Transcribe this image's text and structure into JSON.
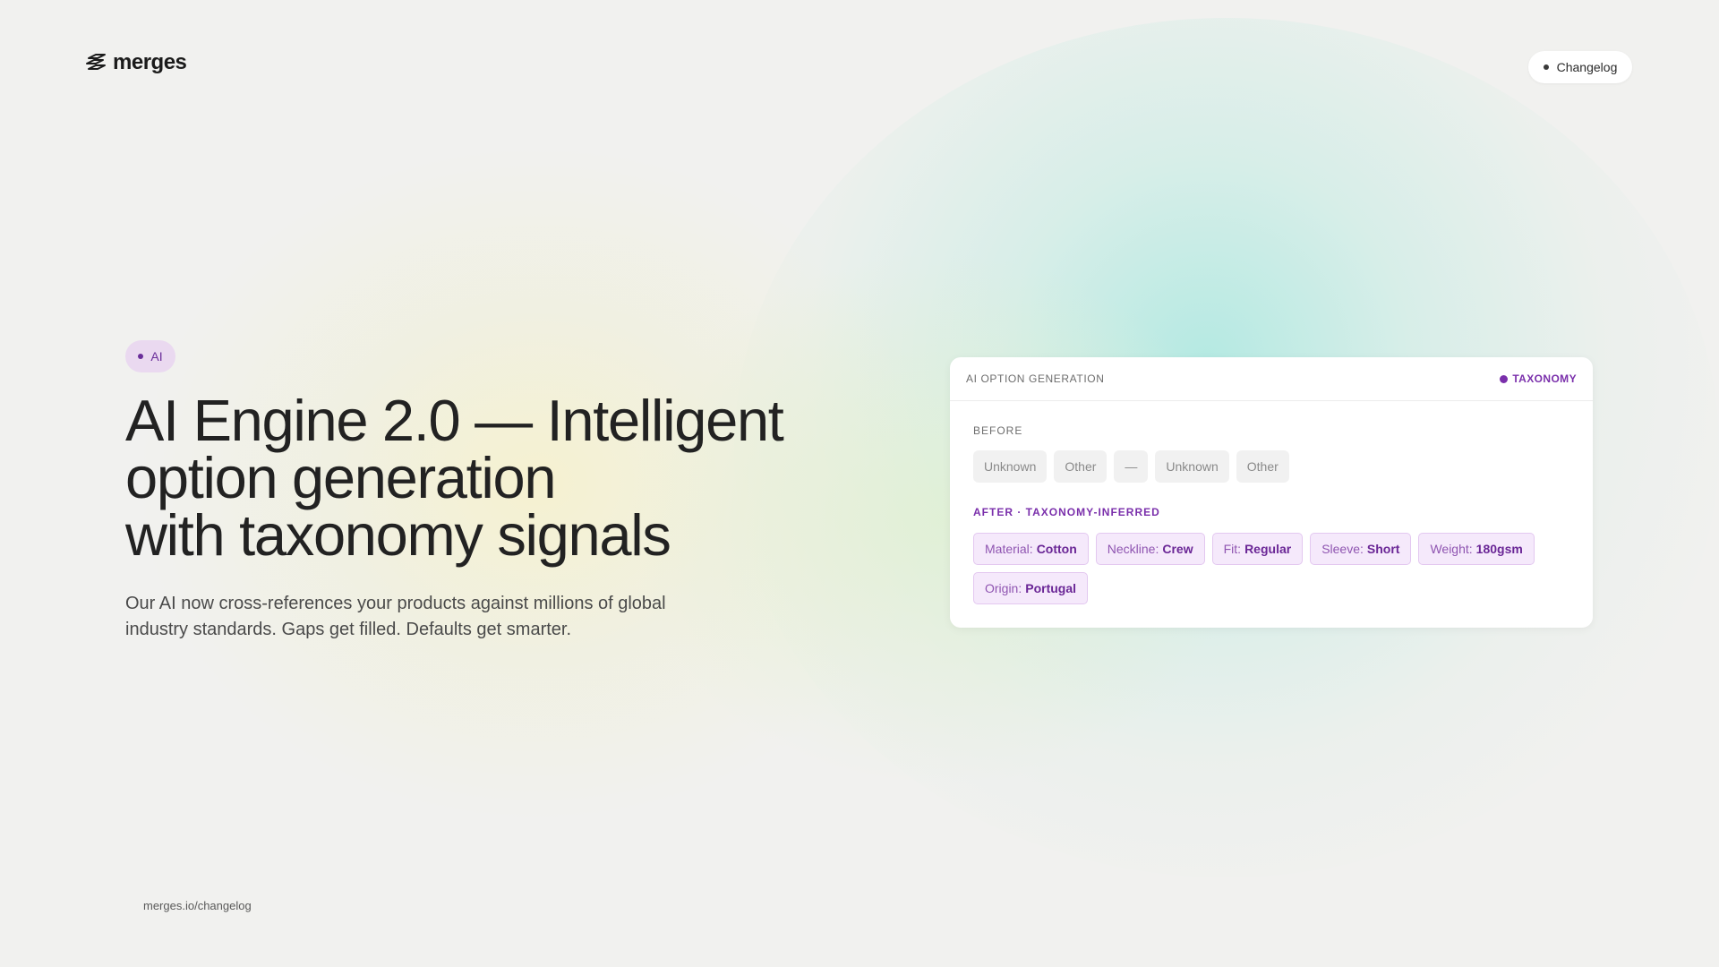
{
  "brand": {
    "name": "merges",
    "logo_icon": "merges-logo-icon"
  },
  "header": {
    "changelog_label": "Changelog"
  },
  "hero": {
    "badge": "AI",
    "headline_lines": [
      "AI Engine 2.0 — Intelligent",
      "option generation",
      "with taxonomy signals"
    ],
    "subtext": "Our AI now cross-references your products against millions of global industry standards. Gaps get filled. Defaults get smarter."
  },
  "card": {
    "title": "AI OPTION GENERATION",
    "badge": "TAXONOMY",
    "before_label": "BEFORE",
    "before_chips": [
      "Unknown",
      "Other",
      "—",
      "Unknown",
      "Other"
    ],
    "after_label": "AFTER · TAXONOMY-INFERRED",
    "after_chips": [
      {
        "key": "Material:",
        "value": "Cotton"
      },
      {
        "key": "Neckline:",
        "value": "Crew"
      },
      {
        "key": "Fit:",
        "value": "Regular"
      },
      {
        "key": "Sleeve:",
        "value": "Short"
      },
      {
        "key": "Weight:",
        "value": "180gsm"
      },
      {
        "key": "Origin:",
        "value": "Portugal"
      }
    ]
  },
  "footer": {
    "url": "merges.io/changelog"
  },
  "colors": {
    "accent_purple": "#7a2fab",
    "background": "#f1f1ef"
  }
}
